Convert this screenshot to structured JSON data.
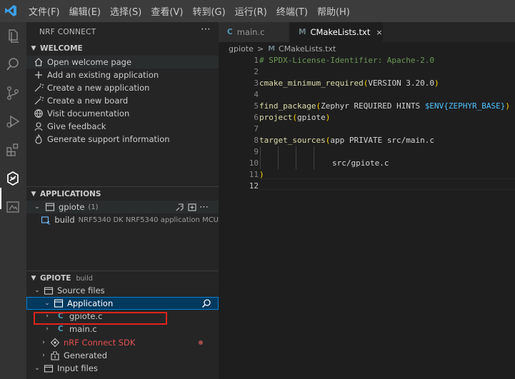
{
  "menu": [
    "文件(F)",
    "编辑(E)",
    "选择(S)",
    "查看(V)",
    "转到(G)",
    "运行(R)",
    "终端(T)",
    "帮助(H)"
  ],
  "sidebar": {
    "title": "NRF CONNECT",
    "welcome": {
      "header": "WELCOME",
      "items": [
        {
          "label": "Open welcome page",
          "icon": "home-icon"
        },
        {
          "label": "Add an existing application",
          "icon": "plus-icon"
        },
        {
          "label": "Create a new application",
          "icon": "wand-icon"
        },
        {
          "label": "Create a new board",
          "icon": "board-icon"
        },
        {
          "label": "Visit documentation",
          "icon": "globe-icon"
        },
        {
          "label": "Give feedback",
          "icon": "feedback-icon"
        },
        {
          "label": "Generate support information",
          "icon": "flame-icon"
        }
      ]
    },
    "applications": {
      "header": "APPLICATIONS",
      "app_name": "gpiote",
      "app_count": "(1)",
      "build_name": "build",
      "build_desc": "NRF5340 DK NRF5340 application MCU"
    },
    "gpiote": {
      "header": "GPIOTE",
      "header_sub": "build",
      "source_files": "Source files",
      "application": "Application",
      "gpiote_c": "gpiote.c",
      "main_c": "main.c",
      "nrf_sdk": "nRF Connect SDK",
      "generated": "Generated",
      "input_files": "Input files",
      "file_icon_letter": "C"
    }
  },
  "tabs": [
    {
      "label": "main.c",
      "icon": "C",
      "icon_color": "#519aba"
    },
    {
      "label": "CMakeLists.txt",
      "icon": "M",
      "icon_color": "#6d8086",
      "close": "×"
    }
  ],
  "breadcrumb": {
    "folder": "gpiote",
    "sep": ">",
    "file_icon": "M",
    "file": "CMakeLists.txt"
  },
  "code": {
    "line_numbers": [
      "1",
      "2",
      "3",
      "4",
      "5",
      "6",
      "7",
      "8",
      "9",
      "10",
      "11",
      "12"
    ],
    "l1": "# SPDX-License-Identifier: Apache-2.0",
    "l3_fn": "cmake_minimum_required",
    "l3_args": "VERSION 3.20.0",
    "l5_fn": "find_package",
    "l5_args": "Zephyr REQUIRED HINTS ",
    "l5_var": "$ENV{ZEPHYR_BASE}",
    "l6_fn": "project",
    "l6_args": "gpiote",
    "l8_fn": "target_sources",
    "l8_args": "app PRIVATE src/main.c",
    "l10": "src/gpiote.c",
    "l11": ")"
  },
  "colors": {
    "accent": "#007acc",
    "selection": "#04395e",
    "highlight_box": "#e0241b",
    "sdk_red": "#e4504f"
  }
}
